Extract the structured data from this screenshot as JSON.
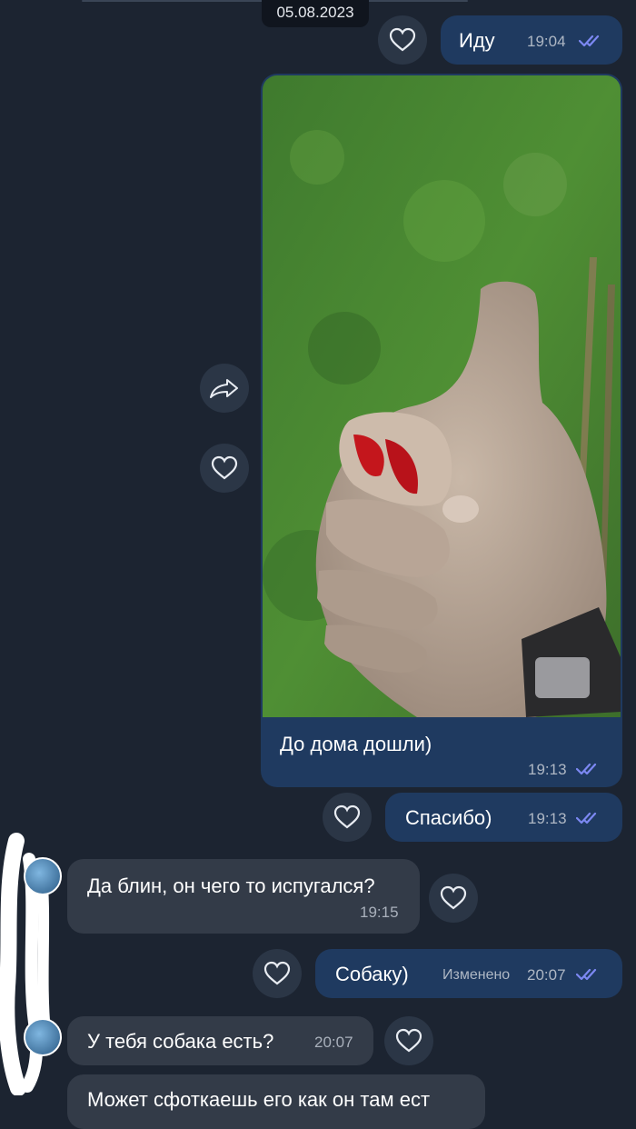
{
  "header": {
    "date": "05.08.2023"
  },
  "messages": {
    "m1": {
      "text": "Иду",
      "time": "19:04"
    },
    "m2": {
      "caption": "До дома дошли)",
      "time": "19:13"
    },
    "m3": {
      "text": "Спасибо)",
      "time": "19:13"
    },
    "m4": {
      "text": "Да блин, он чего то испугался?",
      "time": "19:15"
    },
    "m5": {
      "text": "Собаку)",
      "edited": "Изменено",
      "time": "20:07"
    },
    "m6": {
      "text": "У тебя собака есть?",
      "time": "20:07"
    },
    "m7": {
      "text": "Может сфоткаешь его как он там ест"
    }
  },
  "icons": {
    "like": "heart-icon",
    "forward": "share-arrow-icon",
    "read": "double-check-icon"
  },
  "colors": {
    "background": "#1c2431",
    "outgoing_bubble": "#1f3a60",
    "incoming_bubble": "#333b48",
    "read_check": "#7c88f2"
  }
}
